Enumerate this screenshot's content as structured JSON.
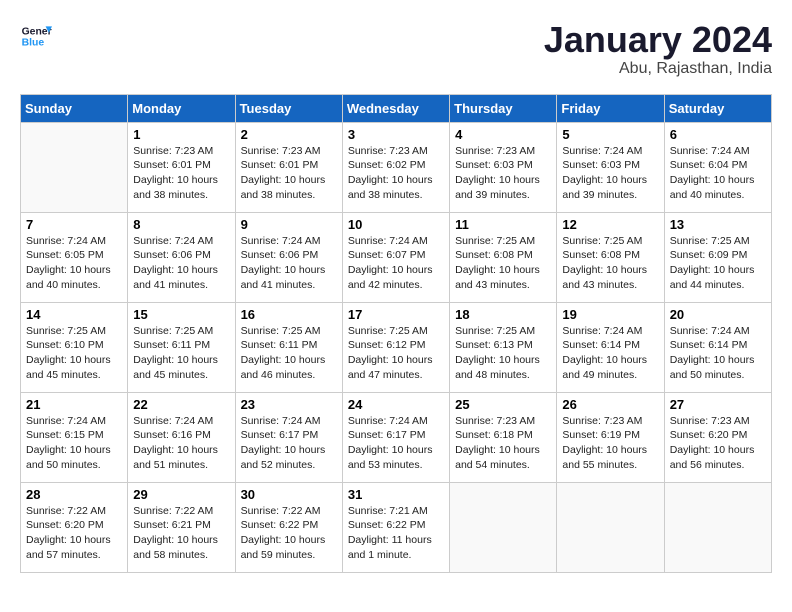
{
  "header": {
    "logo_line1": "General",
    "logo_line2": "Blue",
    "main_title": "January 2024",
    "subtitle": "Abu, Rajasthan, India"
  },
  "days_of_week": [
    "Sunday",
    "Monday",
    "Tuesday",
    "Wednesday",
    "Thursday",
    "Friday",
    "Saturday"
  ],
  "weeks": [
    [
      {
        "day": "",
        "sunrise": "",
        "sunset": "",
        "daylight": ""
      },
      {
        "day": "1",
        "sunrise": "Sunrise: 7:23 AM",
        "sunset": "Sunset: 6:01 PM",
        "daylight": "Daylight: 10 hours and 38 minutes."
      },
      {
        "day": "2",
        "sunrise": "Sunrise: 7:23 AM",
        "sunset": "Sunset: 6:01 PM",
        "daylight": "Daylight: 10 hours and 38 minutes."
      },
      {
        "day": "3",
        "sunrise": "Sunrise: 7:23 AM",
        "sunset": "Sunset: 6:02 PM",
        "daylight": "Daylight: 10 hours and 38 minutes."
      },
      {
        "day": "4",
        "sunrise": "Sunrise: 7:23 AM",
        "sunset": "Sunset: 6:03 PM",
        "daylight": "Daylight: 10 hours and 39 minutes."
      },
      {
        "day": "5",
        "sunrise": "Sunrise: 7:24 AM",
        "sunset": "Sunset: 6:03 PM",
        "daylight": "Daylight: 10 hours and 39 minutes."
      },
      {
        "day": "6",
        "sunrise": "Sunrise: 7:24 AM",
        "sunset": "Sunset: 6:04 PM",
        "daylight": "Daylight: 10 hours and 40 minutes."
      }
    ],
    [
      {
        "day": "7",
        "sunrise": "Sunrise: 7:24 AM",
        "sunset": "Sunset: 6:05 PM",
        "daylight": "Daylight: 10 hours and 40 minutes."
      },
      {
        "day": "8",
        "sunrise": "Sunrise: 7:24 AM",
        "sunset": "Sunset: 6:06 PM",
        "daylight": "Daylight: 10 hours and 41 minutes."
      },
      {
        "day": "9",
        "sunrise": "Sunrise: 7:24 AM",
        "sunset": "Sunset: 6:06 PM",
        "daylight": "Daylight: 10 hours and 41 minutes."
      },
      {
        "day": "10",
        "sunrise": "Sunrise: 7:24 AM",
        "sunset": "Sunset: 6:07 PM",
        "daylight": "Daylight: 10 hours and 42 minutes."
      },
      {
        "day": "11",
        "sunrise": "Sunrise: 7:25 AM",
        "sunset": "Sunset: 6:08 PM",
        "daylight": "Daylight: 10 hours and 43 minutes."
      },
      {
        "day": "12",
        "sunrise": "Sunrise: 7:25 AM",
        "sunset": "Sunset: 6:08 PM",
        "daylight": "Daylight: 10 hours and 43 minutes."
      },
      {
        "day": "13",
        "sunrise": "Sunrise: 7:25 AM",
        "sunset": "Sunset: 6:09 PM",
        "daylight": "Daylight: 10 hours and 44 minutes."
      }
    ],
    [
      {
        "day": "14",
        "sunrise": "Sunrise: 7:25 AM",
        "sunset": "Sunset: 6:10 PM",
        "daylight": "Daylight: 10 hours and 45 minutes."
      },
      {
        "day": "15",
        "sunrise": "Sunrise: 7:25 AM",
        "sunset": "Sunset: 6:11 PM",
        "daylight": "Daylight: 10 hours and 45 minutes."
      },
      {
        "day": "16",
        "sunrise": "Sunrise: 7:25 AM",
        "sunset": "Sunset: 6:11 PM",
        "daylight": "Daylight: 10 hours and 46 minutes."
      },
      {
        "day": "17",
        "sunrise": "Sunrise: 7:25 AM",
        "sunset": "Sunset: 6:12 PM",
        "daylight": "Daylight: 10 hours and 47 minutes."
      },
      {
        "day": "18",
        "sunrise": "Sunrise: 7:25 AM",
        "sunset": "Sunset: 6:13 PM",
        "daylight": "Daylight: 10 hours and 48 minutes."
      },
      {
        "day": "19",
        "sunrise": "Sunrise: 7:24 AM",
        "sunset": "Sunset: 6:14 PM",
        "daylight": "Daylight: 10 hours and 49 minutes."
      },
      {
        "day": "20",
        "sunrise": "Sunrise: 7:24 AM",
        "sunset": "Sunset: 6:14 PM",
        "daylight": "Daylight: 10 hours and 50 minutes."
      }
    ],
    [
      {
        "day": "21",
        "sunrise": "Sunrise: 7:24 AM",
        "sunset": "Sunset: 6:15 PM",
        "daylight": "Daylight: 10 hours and 50 minutes."
      },
      {
        "day": "22",
        "sunrise": "Sunrise: 7:24 AM",
        "sunset": "Sunset: 6:16 PM",
        "daylight": "Daylight: 10 hours and 51 minutes."
      },
      {
        "day": "23",
        "sunrise": "Sunrise: 7:24 AM",
        "sunset": "Sunset: 6:17 PM",
        "daylight": "Daylight: 10 hours and 52 minutes."
      },
      {
        "day": "24",
        "sunrise": "Sunrise: 7:24 AM",
        "sunset": "Sunset: 6:17 PM",
        "daylight": "Daylight: 10 hours and 53 minutes."
      },
      {
        "day": "25",
        "sunrise": "Sunrise: 7:23 AM",
        "sunset": "Sunset: 6:18 PM",
        "daylight": "Daylight: 10 hours and 54 minutes."
      },
      {
        "day": "26",
        "sunrise": "Sunrise: 7:23 AM",
        "sunset": "Sunset: 6:19 PM",
        "daylight": "Daylight: 10 hours and 55 minutes."
      },
      {
        "day": "27",
        "sunrise": "Sunrise: 7:23 AM",
        "sunset": "Sunset: 6:20 PM",
        "daylight": "Daylight: 10 hours and 56 minutes."
      }
    ],
    [
      {
        "day": "28",
        "sunrise": "Sunrise: 7:22 AM",
        "sunset": "Sunset: 6:20 PM",
        "daylight": "Daylight: 10 hours and 57 minutes."
      },
      {
        "day": "29",
        "sunrise": "Sunrise: 7:22 AM",
        "sunset": "Sunset: 6:21 PM",
        "daylight": "Daylight: 10 hours and 58 minutes."
      },
      {
        "day": "30",
        "sunrise": "Sunrise: 7:22 AM",
        "sunset": "Sunset: 6:22 PM",
        "daylight": "Daylight: 10 hours and 59 minutes."
      },
      {
        "day": "31",
        "sunrise": "Sunrise: 7:21 AM",
        "sunset": "Sunset: 6:22 PM",
        "daylight": "Daylight: 11 hours and 1 minute."
      },
      {
        "day": "",
        "sunrise": "",
        "sunset": "",
        "daylight": ""
      },
      {
        "day": "",
        "sunrise": "",
        "sunset": "",
        "daylight": ""
      },
      {
        "day": "",
        "sunrise": "",
        "sunset": "",
        "daylight": ""
      }
    ]
  ]
}
